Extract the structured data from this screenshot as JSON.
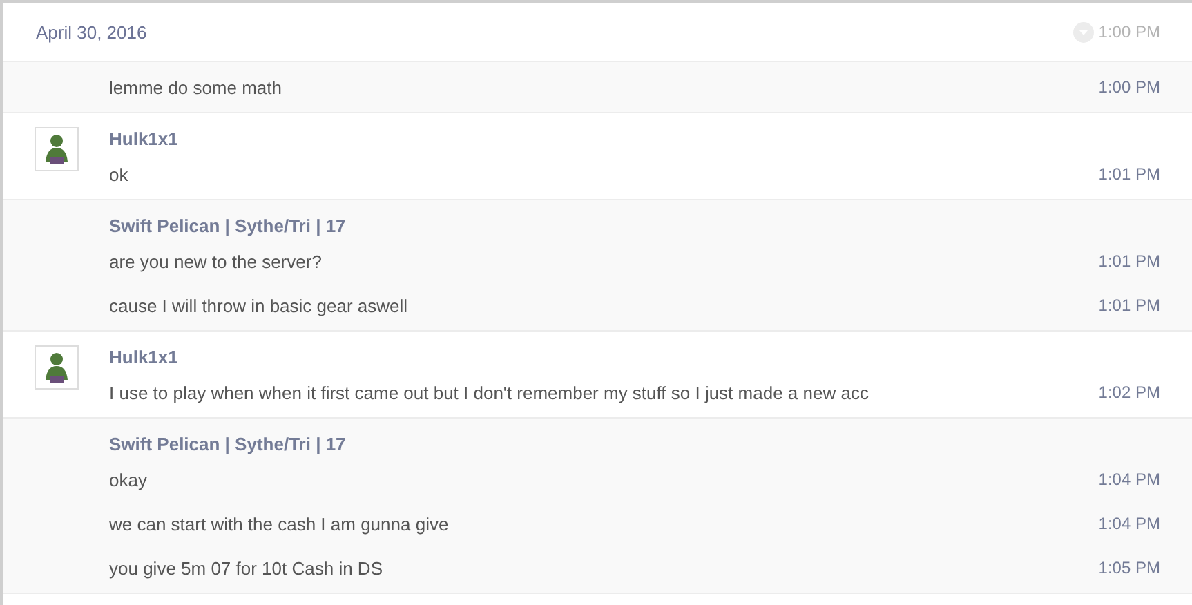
{
  "header": {
    "date": "April 30, 2016",
    "faded_time": "1:00 PM"
  },
  "groups": [
    {
      "avatar": false,
      "messages": [
        {
          "text": "lemme do some math",
          "time": "1:00 PM"
        }
      ]
    },
    {
      "avatar": true,
      "sender": "Hulk1x1",
      "messages": [
        {
          "text": "ok",
          "time": "1:01 PM"
        }
      ]
    },
    {
      "avatar": false,
      "sender": "Swift Pelican | Sythe/Tri | 17",
      "messages": [
        {
          "text": "are you new to the server?",
          "time": "1:01 PM"
        },
        {
          "text": "cause I will throw in basic gear aswell",
          "time": "1:01 PM"
        }
      ]
    },
    {
      "avatar": true,
      "sender": "Hulk1x1",
      "messages": [
        {
          "text": "I use to play when when it first came out but I don't remember my stuff so I just made a new acc",
          "time": "1:02 PM"
        }
      ]
    },
    {
      "avatar": false,
      "sender": "Swift Pelican | Sythe/Tri | 17",
      "messages": [
        {
          "text": "okay",
          "time": "1:04 PM"
        },
        {
          "text": "we can start with the cash I am gunna give",
          "time": "1:04 PM"
        },
        {
          "text": "you give 5m 07 for 10t Cash in DS",
          "time": "1:05 PM"
        }
      ]
    }
  ]
}
